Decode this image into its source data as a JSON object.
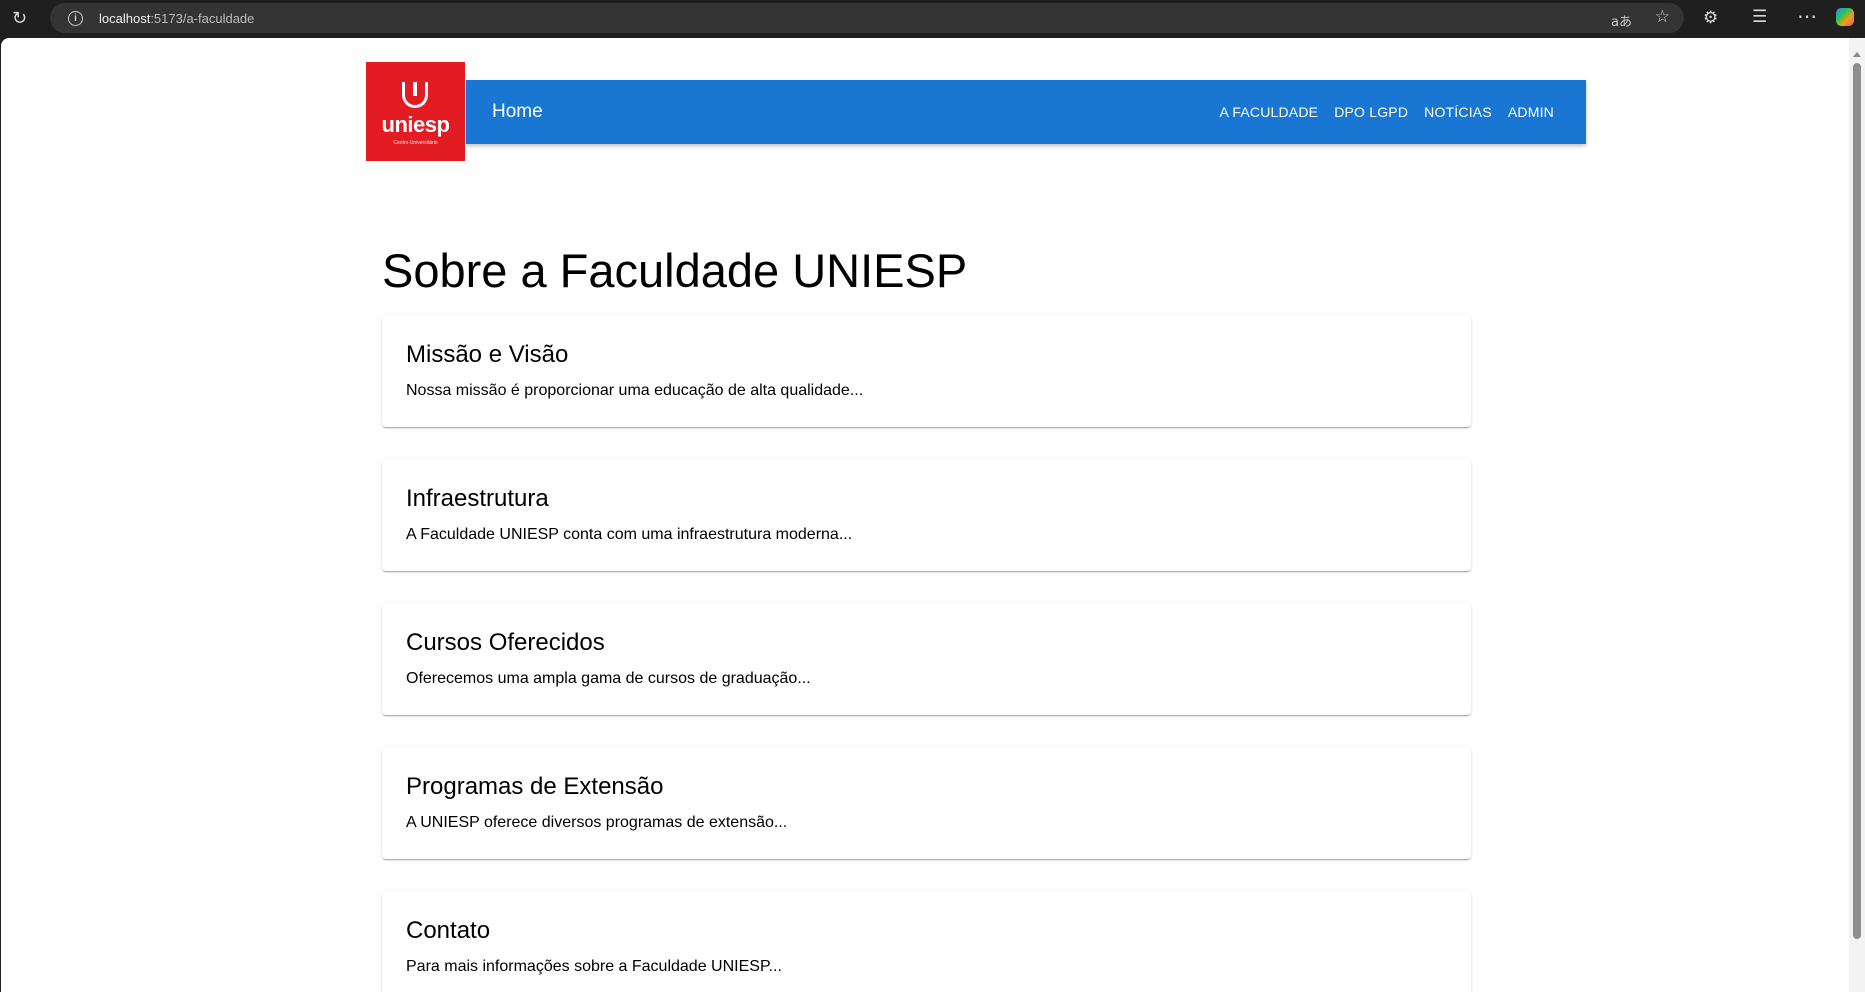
{
  "browser": {
    "url_host": "localhost",
    "url_path": ":5173/a-faculdade"
  },
  "logo": {
    "word": "uniesp",
    "subtitle": "Centro Universitário"
  },
  "nav": {
    "home": "Home",
    "links": [
      "A FACULDADE",
      "DPO LGPD",
      "NOTÍCIAS",
      "ADMIN"
    ]
  },
  "page": {
    "title": "Sobre a Faculdade UNIESP",
    "cards": [
      {
        "title": "Missão e Visão",
        "text": "Nossa missão é proporcionar uma educação de alta qualidade..."
      },
      {
        "title": "Infraestrutura",
        "text": "A Faculdade UNIESP conta com uma infraestrutura moderna..."
      },
      {
        "title": "Cursos Oferecidos",
        "text": "Oferecemos uma ampla gama de cursos de graduação..."
      },
      {
        "title": "Programas de Extensão",
        "text": "A UNIESP oferece diversos programas de extensão..."
      },
      {
        "title": "Contato",
        "text": "Para mais informações sobre a Faculdade UNIESP..."
      }
    ]
  },
  "colors": {
    "appbar": "#1976d2",
    "logo_bg": "#e31b23"
  }
}
